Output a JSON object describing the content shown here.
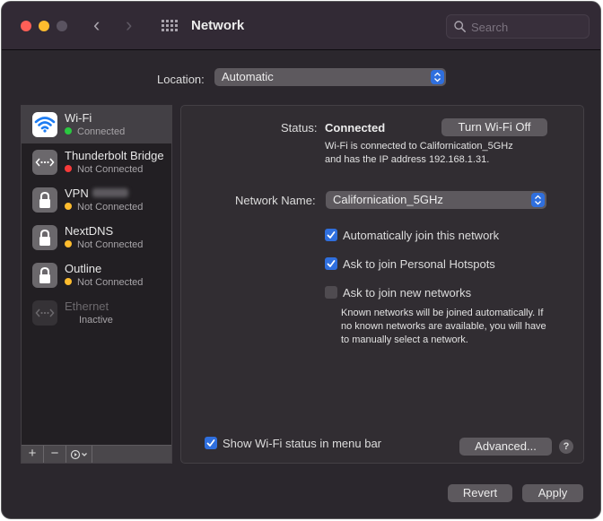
{
  "window": {
    "title": "Network",
    "search_placeholder": "Search"
  },
  "location": {
    "label": "Location:",
    "value": "Automatic"
  },
  "services": [
    {
      "name": "Wi-Fi",
      "status": "Connected",
      "status_color": "#2ac840",
      "icon": "wifi-icon",
      "selected": true
    },
    {
      "name": "Thunderbolt Bridge",
      "status": "Not Connected",
      "status_color": "#f73a3a",
      "icon": "ethernet-dots-icon"
    },
    {
      "name": "VPN",
      "status": "Not Connected",
      "status_color": "#febc2e",
      "icon": "lock-icon"
    },
    {
      "name": "NextDNS",
      "status": "Not Connected",
      "status_color": "#febc2e",
      "icon": "lock-icon"
    },
    {
      "name": "Outline",
      "status": "Not Connected",
      "status_color": "#febc2e",
      "icon": "lock-icon"
    },
    {
      "name": "Ethernet",
      "status": "Inactive",
      "icon": "ethernet-dots-icon",
      "inactive": true
    }
  ],
  "sidebar_toolbar": {
    "add": "+",
    "remove": "−"
  },
  "detail": {
    "status_label": "Status:",
    "status_value": "Connected",
    "turn_off_button": "Turn Wi-Fi Off",
    "status_desc_line1": "Wi-Fi is connected to Californication_5GHz",
    "status_desc_line2": "and has the IP address 192.168.1.31.",
    "network_name_label": "Network Name:",
    "network_name_value": "Californication_5GHz",
    "checkboxes": [
      {
        "label": "Automatically join this network",
        "checked": true
      },
      {
        "label": "Ask to join Personal Hotspots",
        "checked": true
      },
      {
        "label": "Ask to join new networks",
        "checked": false
      }
    ],
    "help_line1": "Known networks will be joined automatically. If",
    "help_line2": "no known networks are available, you will have",
    "help_line3": "to manually select a network.",
    "show_status_label": "Show Wi-Fi status in menu bar",
    "show_status_checked": true,
    "advanced_button": "Advanced...",
    "help_button": "?"
  },
  "footer": {
    "revert_button": "Revert",
    "apply_button": "Apply"
  },
  "colors": {
    "accent": "#2f6fde"
  }
}
